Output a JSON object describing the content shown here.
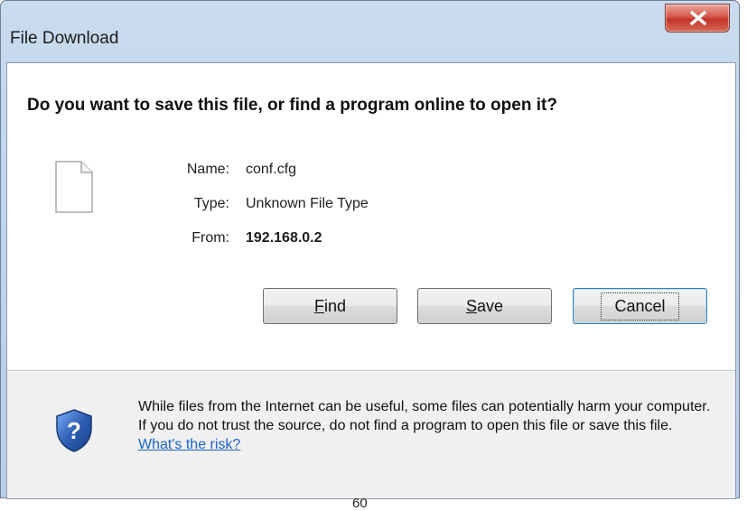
{
  "window": {
    "title": "File Download"
  },
  "dialog": {
    "question": "Do you want to save this file, or find a program online to open it?",
    "name_label": "Name:",
    "name_value": "conf.cfg",
    "type_label": "Type:",
    "type_value": "Unknown File Type",
    "from_label": "From:",
    "from_value": "192.168.0.2"
  },
  "buttons": {
    "find": {
      "pre": "",
      "access": "F",
      "post": "ind"
    },
    "save": {
      "pre": "",
      "access": "S",
      "post": "ave"
    },
    "cancel": "Cancel"
  },
  "warning": {
    "text": "While files from the Internet can be useful, some files can potentially harm your computer. If you do not trust the source, do not find a program to open this file or save this file.",
    "link": "What's the risk?"
  },
  "footer": {
    "page_number": "60"
  },
  "icons": {
    "close": "close-icon",
    "file": "file-icon",
    "shield": "shield-question-icon"
  },
  "colors": {
    "link": "#1a63c7",
    "close_button": "#c3352a",
    "shield": "#2f5fb3"
  }
}
